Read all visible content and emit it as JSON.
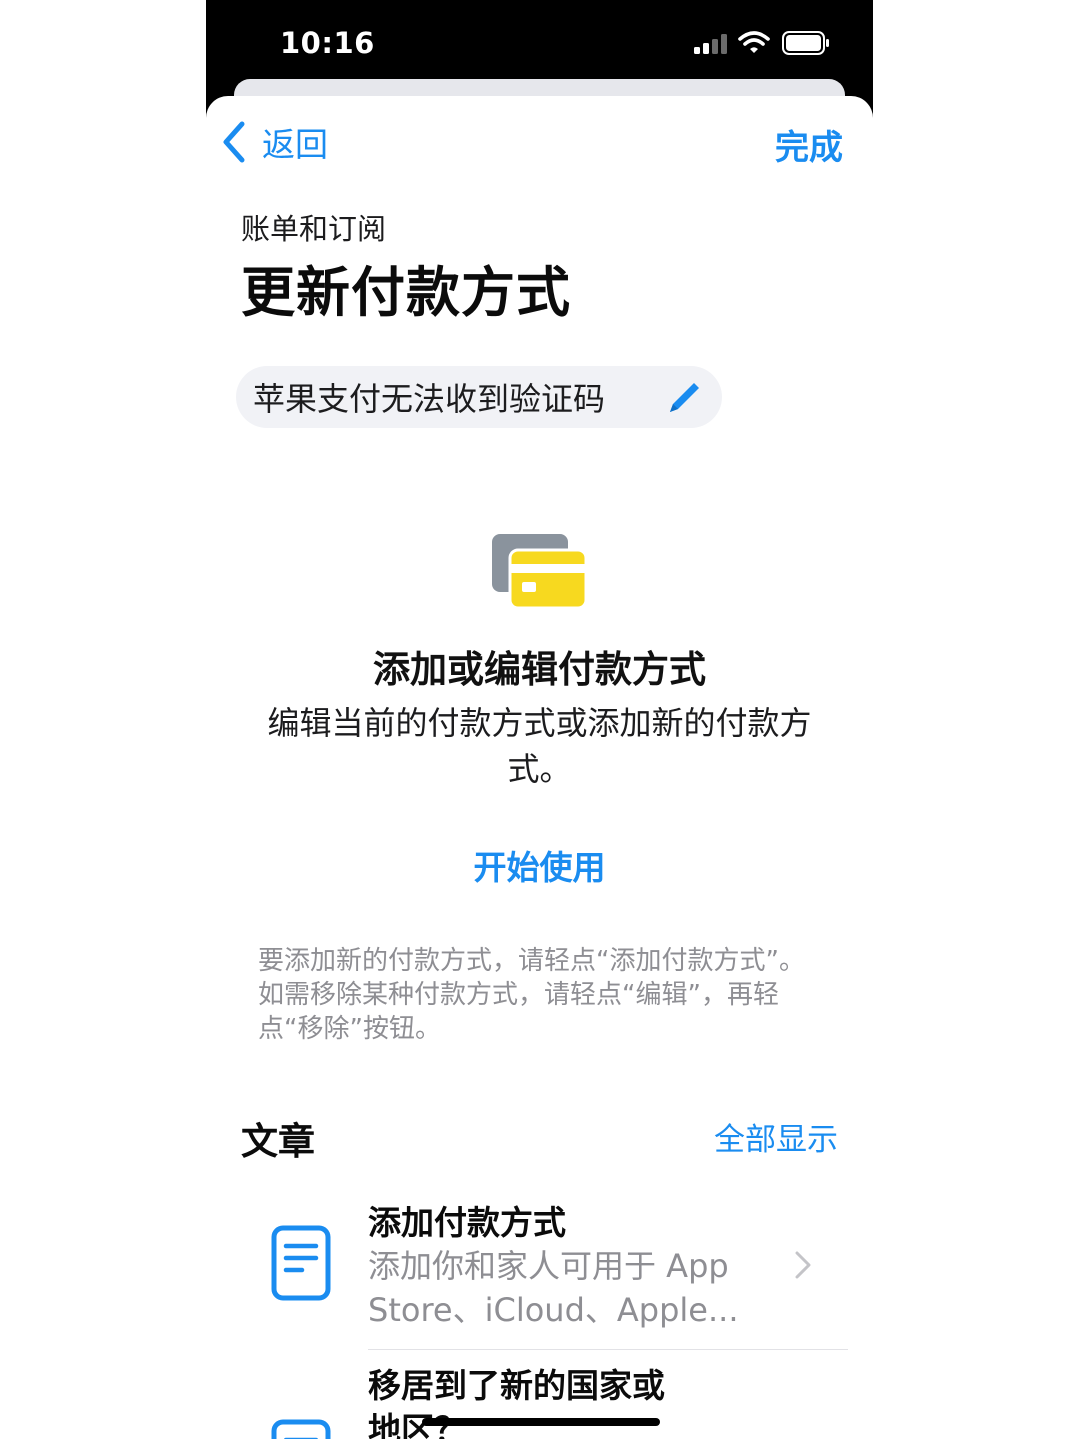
{
  "status_bar": {
    "time": "10:16"
  },
  "nav": {
    "back_label": "返回",
    "done_label": "完成"
  },
  "header": {
    "breadcrumb": "账单和订阅",
    "title": "更新付款方式"
  },
  "search_chip": {
    "query": "苹果支付无法收到验证码"
  },
  "feature": {
    "title": "添加或编辑付款方式",
    "description": "编辑当前的付款方式或添加新的付款方式。",
    "action_label": "开始使用"
  },
  "help_text": "要添加新的付款方式，请轻点“添加付款方式”。如需移除某种付款方式，请轻点“编辑”，再轻点“移除”按钮。",
  "articles": {
    "section_title": "文章",
    "show_all_label": "全部显示",
    "items": [
      {
        "title": "添加付款方式",
        "description": "添加你和家人可用于 App Store、iCloud、Apple..."
      },
      {
        "title": "移居到了新的国家或地区？",
        "description": ""
      }
    ]
  },
  "colors": {
    "accent": "#1a8cf0",
    "card_yellow": "#f7d91f",
    "card_gray": "#8a939d",
    "secondary_text": "#8e8e93"
  }
}
